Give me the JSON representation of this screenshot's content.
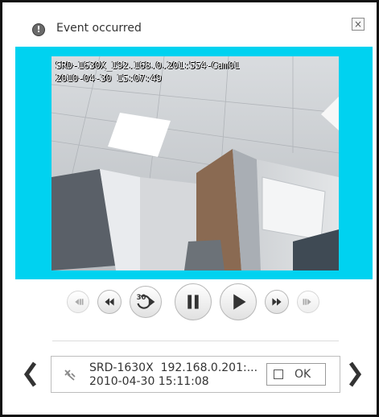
{
  "window": {
    "title": "Event occurred",
    "title_icon": "alert-icon",
    "close_label": "×"
  },
  "video": {
    "camera_label": "SRD-1630X_192.168.0.201:554-Cam01",
    "timestamp": "2010-04-30 15:07:49",
    "background_color": "#00d2f0"
  },
  "controls": [
    {
      "name": "go-to-start",
      "icon": "skip-back-icon",
      "enabled": false
    },
    {
      "name": "rewind",
      "icon": "rewind-icon",
      "enabled": true
    },
    {
      "name": "back-30s",
      "icon": "replay-30-icon",
      "label": "30",
      "enabled": true
    },
    {
      "name": "pause",
      "icon": "pause-icon",
      "enabled": true
    },
    {
      "name": "play",
      "icon": "play-icon",
      "enabled": true
    },
    {
      "name": "fast-forward",
      "icon": "fast-forward-icon",
      "enabled": true
    },
    {
      "name": "go-to-end",
      "icon": "skip-forward-icon",
      "enabled": false
    }
  ],
  "event": {
    "device": "SRD-1630X",
    "address": "192.168.0.201:...",
    "time": "2010-04-30 15:11:08",
    "icon": "event-sensor-icon",
    "ok_label": "OK",
    "ok_checked": false
  },
  "nav": {
    "prev_icon": "chevron-left-icon",
    "next_icon": "chevron-right-icon"
  }
}
